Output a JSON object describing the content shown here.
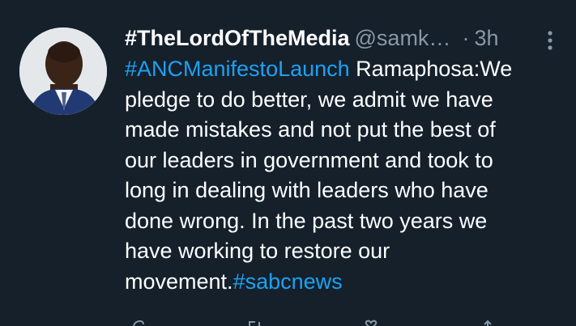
{
  "tweet": {
    "display_name": "#TheLordOfTheMedia",
    "handle": "@samk…",
    "separator": "·",
    "time": "3h",
    "text_lines": [
      [
        {
          "text": "#ANCManifestoLaunch",
          "type": "hashtag"
        },
        {
          "text": " Ramaphosa:We",
          "type": "text"
        }
      ],
      [
        {
          "text": "pledge to do better, we admit we have",
          "type": "text"
        }
      ],
      [
        {
          "text": "made mistakes and not put the best of",
          "type": "text"
        }
      ],
      [
        {
          "text": "our leaders in government and took to",
          "type": "text"
        }
      ],
      [
        {
          "text": "long in dealing with leaders who have",
          "type": "text"
        }
      ],
      [
        {
          "text": "done wrong. In the past two years we",
          "type": "text"
        }
      ],
      [
        {
          "text": "have working to restore our",
          "type": "text"
        }
      ],
      [
        {
          "text": "movement.",
          "type": "text"
        },
        {
          "text": "#sabcnews",
          "type": "hashtag"
        }
      ]
    ]
  },
  "icons": {
    "avatar": "avatar-image",
    "more": "more-vertical-icon",
    "reply": "reply-icon",
    "retweet": "retweet-icon",
    "like": "like-icon",
    "share": "share-icon"
  },
  "colors": {
    "background": "#15202b",
    "primary_text": "#ffffff",
    "secondary_text": "#8899a6",
    "link": "#1da1f2"
  }
}
